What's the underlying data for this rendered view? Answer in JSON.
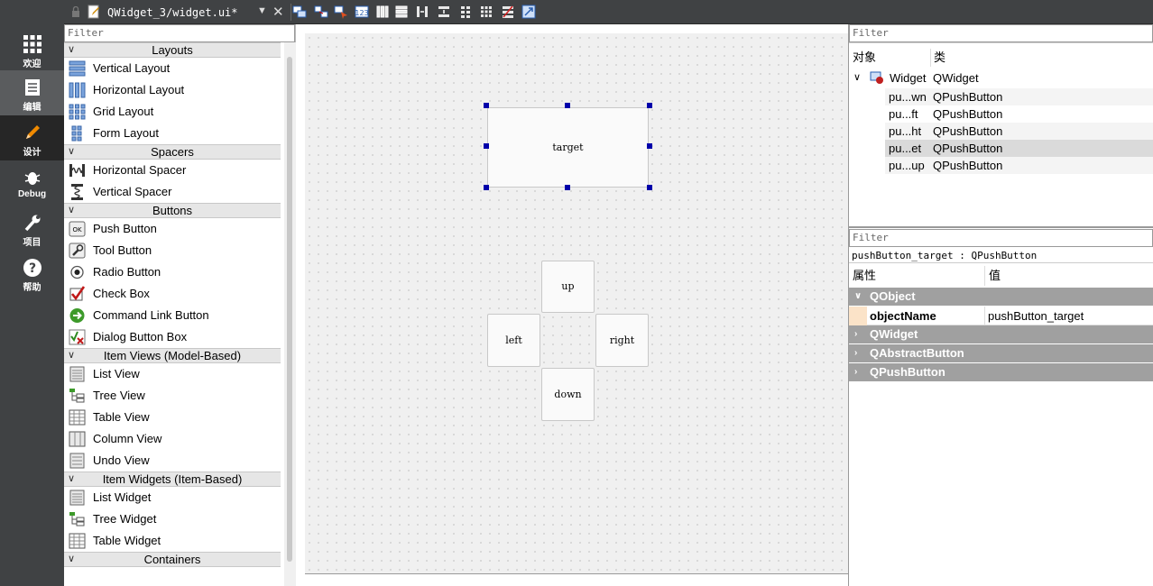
{
  "modes": [
    {
      "label": "欢迎",
      "icon": "grid-icon"
    },
    {
      "label": "编辑",
      "icon": "document-icon"
    },
    {
      "label": "设计",
      "icon": "pencil-icon"
    },
    {
      "label": "Debug",
      "icon": "bug-icon"
    },
    {
      "label": "项目",
      "icon": "wrench-icon"
    },
    {
      "label": "帮助",
      "icon": "help-icon"
    }
  ],
  "toolbar": {
    "file_name": "QWidget_3/widget.ui*"
  },
  "widgetbox": {
    "filter_placeholder": "Filter",
    "categories": [
      {
        "name": "Layouts",
        "items": [
          "Vertical Layout",
          "Horizontal Layout",
          "Grid Layout",
          "Form Layout"
        ]
      },
      {
        "name": "Spacers",
        "items": [
          "Horizontal Spacer",
          "Vertical Spacer"
        ]
      },
      {
        "name": "Buttons",
        "items": [
          "Push Button",
          "Tool Button",
          "Radio Button",
          "Check Box",
          "Command Link Button",
          "Dialog Button Box"
        ]
      },
      {
        "name": "Item Views (Model-Based)",
        "items": [
          "List View",
          "Tree View",
          "Table View",
          "Column View",
          "Undo View"
        ]
      },
      {
        "name": "Item Widgets (Item-Based)",
        "items": [
          "List Widget",
          "Tree Widget",
          "Table Widget"
        ]
      },
      {
        "name": "Containers",
        "items": []
      }
    ]
  },
  "form": {
    "buttons": {
      "target": "target",
      "up": "up",
      "left": "left",
      "right": "right",
      "down": "down"
    }
  },
  "object_inspector": {
    "filter_placeholder": "Filter",
    "col_object": "对象",
    "col_class": "类",
    "root": {
      "name": "Widget",
      "class": "QWidget"
    },
    "children": [
      {
        "name": "pu...wn",
        "class": "QPushButton"
      },
      {
        "name": "pu...ft",
        "class": "QPushButton"
      },
      {
        "name": "pu...ht",
        "class": "QPushButton"
      },
      {
        "name": "pu...et",
        "class": "QPushButton",
        "selected": true
      },
      {
        "name": "pu...up",
        "class": "QPushButton"
      }
    ]
  },
  "property_editor": {
    "filter_placeholder": "Filter",
    "selection_label": "pushButton_target : QPushButton",
    "col_property": "属性",
    "col_value": "值",
    "groups": [
      "QObject",
      "QWidget",
      "QAbstractButton",
      "QPushButton"
    ],
    "object_name_label": "objectName",
    "object_name_value": "pushButton_target"
  }
}
